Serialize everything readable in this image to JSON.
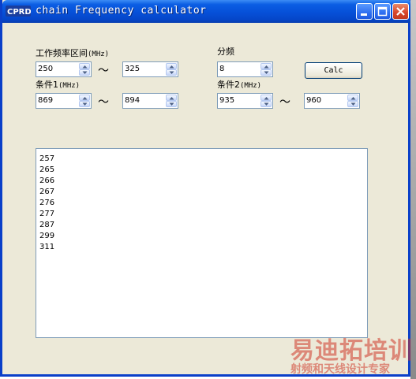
{
  "window": {
    "title": "chain Frequency calculator",
    "icon_text": "CPRD",
    "buttons": [
      "minimize-icon",
      "maximize-icon",
      "close-icon"
    ],
    "colors": {
      "titlebar": "#0650d8",
      "client": "#ece9d8",
      "border": "#0a3fc9",
      "close": "#d8452a"
    }
  },
  "form": {
    "freq_range_label": "工作频率区间",
    "freq_range_unit": "(MHz)",
    "freq_min": "250",
    "freq_max": "325",
    "divider_label": "分频",
    "divider_value": "8",
    "calc_label": "Calc",
    "cond1_label": "条件1",
    "cond1_unit": "(MHz)",
    "cond1_min": "869",
    "cond1_max": "894",
    "cond2_label": "条件2",
    "cond2_unit": "(MHz)",
    "cond2_min": "935",
    "cond2_max": "960",
    "tilde": "～"
  },
  "results": [
    "257",
    "265",
    "266",
    "267",
    "276",
    "277",
    "287",
    "299",
    "311"
  ],
  "watermark": {
    "main": "易迪拓培训",
    "sub": "射频和天线设计专家"
  }
}
